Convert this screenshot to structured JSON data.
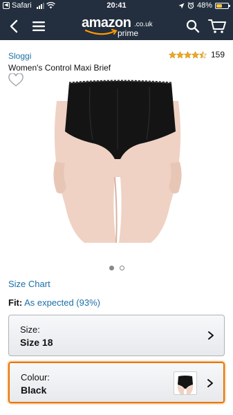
{
  "status_bar": {
    "back_app": "Safari",
    "time": "20:41",
    "battery_text": "48%",
    "battery_level": 0.48,
    "battery_color": "#f5c542"
  },
  "nav": {
    "background": "#232f3e",
    "logo_word": "amazon",
    "logo_tld": ".co.uk",
    "logo_sub": "prime",
    "icons": [
      "chevron-left-icon",
      "hamburger-menu-icon",
      "search-icon",
      "cart-icon"
    ]
  },
  "product": {
    "brand": "Sloggi",
    "title": "Women's Control Maxi Brief",
    "rating_stars": 4.5,
    "rating_count": "159",
    "image_icon": "product-photo",
    "carousel": {
      "total": 2,
      "active": 1
    }
  },
  "links": {
    "size_chart": "Size Chart"
  },
  "fit": {
    "label": "Fit:",
    "value": "As expected (93%)"
  },
  "size_selector": {
    "label": "Size:",
    "value": "Size 18"
  },
  "colour_selector": {
    "label": "Colour:",
    "value": "Black",
    "accent": "#e77600"
  },
  "colors": {
    "link": "#1a6fa8",
    "star": "#f0a81a"
  }
}
